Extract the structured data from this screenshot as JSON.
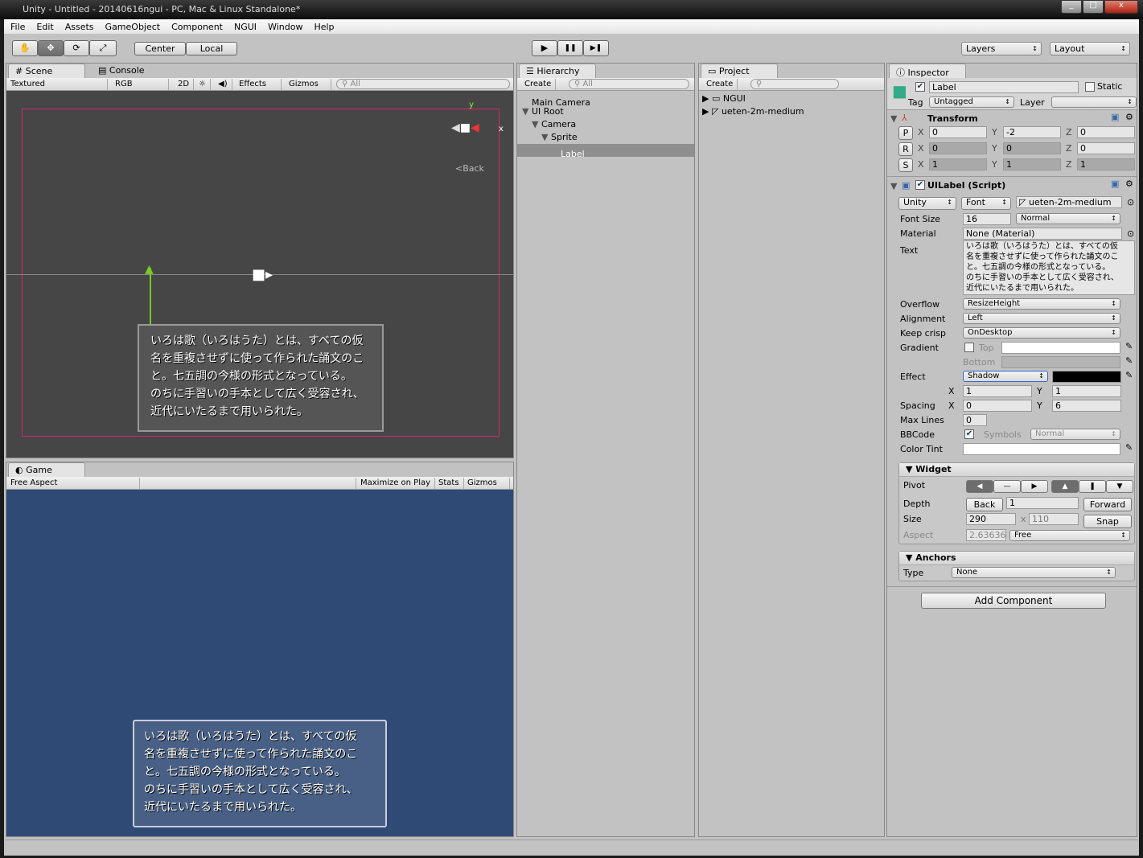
{
  "window": {
    "title": "Unity - Untitled - 20140616ngui - PC, Mac & Linux Standalone*",
    "min": "_",
    "max": "□",
    "close": "x"
  },
  "menu": [
    "File",
    "Edit",
    "Assets",
    "GameObject",
    "Component",
    "NGUI",
    "Window",
    "Help"
  ],
  "toolbar": {
    "tools": [
      "✋",
      "✥",
      "⟳",
      "⤢"
    ],
    "center": "Center",
    "local": "Local",
    "play": "▶",
    "pause": "❚❚",
    "step": "▶❚",
    "layers": "Layers",
    "layout": "Layout"
  },
  "scene": {
    "tab": "Scene",
    "tab2": "Console",
    "render_mode": "Textured",
    "color_mode": "RGB",
    "mode_2d": "2D",
    "effects": "Effects",
    "gizmos": "Gizmos",
    "search": "All",
    "gizmo_y": "y",
    "gizmo_x": "x",
    "back": "Back"
  },
  "label_text": [
    "いろは歌（いろはうた）とは、すべての仮",
    "名を重複させずに使って作られた誦文のこ",
    "と。七五調の今様の形式となっている。",
    "のちに手習いの手本として広く受容され、",
    "近代にいたるまで用いられた。"
  ],
  "game": {
    "tab": "Game",
    "aspect": "Free Aspect",
    "maximize": "Maximize on Play",
    "stats": "Stats",
    "gizmos": "Gizmos"
  },
  "hierarchy": {
    "tab": "Hierarchy",
    "create": "Create",
    "search": "All",
    "items": [
      {
        "label": "Main Camera",
        "depth": 0
      },
      {
        "label": "UI Root",
        "depth": 0,
        "expanded": true
      },
      {
        "label": "Camera",
        "depth": 1,
        "expanded": true
      },
      {
        "label": "Sprite",
        "depth": 2,
        "expanded": true
      },
      {
        "label": "Label",
        "depth": 3,
        "selected": true
      }
    ]
  },
  "project": {
    "tab": "Project",
    "create": "Create",
    "items": [
      "NGUI",
      "ueten-2m-medium"
    ]
  },
  "inspector": {
    "tab": "Inspector",
    "name": "Label",
    "static": "Static",
    "tag_label": "Tag",
    "tag": "Untagged",
    "layer_label": "Layer",
    "layer": "",
    "transform": {
      "title": "Transform",
      "p": "P",
      "r": "R",
      "s": "S",
      "position": [
        "0",
        "-2",
        "0"
      ],
      "rotation": [
        "0",
        "0",
        "0"
      ],
      "scale": [
        "1",
        "1",
        "1"
      ]
    },
    "uilabel": {
      "title": "UILabel (Script)",
      "font_type": "Unity",
      "font_kind": "Font",
      "font": "ueten-2m-medium",
      "font_size_label": "Font Size",
      "font_size": "16",
      "font_style": "Normal",
      "material_label": "Material",
      "material": "None (Material)",
      "text_label": "Text",
      "overflow_label": "Overflow",
      "overflow": "ResizeHeight",
      "alignment_label": "Alignment",
      "alignment": "Left",
      "keep_crisp_label": "Keep crisp",
      "keep_crisp": "OnDesktop",
      "gradient_label": "Gradient",
      "top": "Top",
      "bottom": "Bottom",
      "effect_label": "Effect",
      "effect": "Shadow",
      "effect_color": "#000000",
      "effect_x": "1",
      "effect_y": "1",
      "spacing_label": "Spacing",
      "spacing_x": "0",
      "spacing_y": "6",
      "max_lines_label": "Max Lines",
      "max_lines": "0",
      "bbcode_label": "BBCode",
      "symbols_label": "Symbols",
      "symbols": "Normal",
      "color_tint_label": "Color Tint"
    },
    "widget": {
      "title": "▼ Widget",
      "pivot_label": "Pivot",
      "pivot": [
        "◀",
        "—",
        "▶",
        "▲",
        "❚",
        "▼"
      ],
      "depth_label": "Depth",
      "back": "Back",
      "depth": "1",
      "forward": "Forward",
      "size_label": "Size",
      "width": "290",
      "x": "x",
      "height": "110",
      "snap": "Snap",
      "aspect_label": "Aspect",
      "aspect": "2.63636",
      "aspect_mode": "Free"
    },
    "anchors": {
      "title": "▼ Anchors",
      "type_label": "Type",
      "type": "None"
    },
    "add_component": "Add Component"
  },
  "labels": {
    "x": "X",
    "y": "Y",
    "z": "Z"
  },
  "colors": {
    "scene_bg": "#464646",
    "game_bg": "#2f4b75",
    "selection": "#dd2266"
  }
}
